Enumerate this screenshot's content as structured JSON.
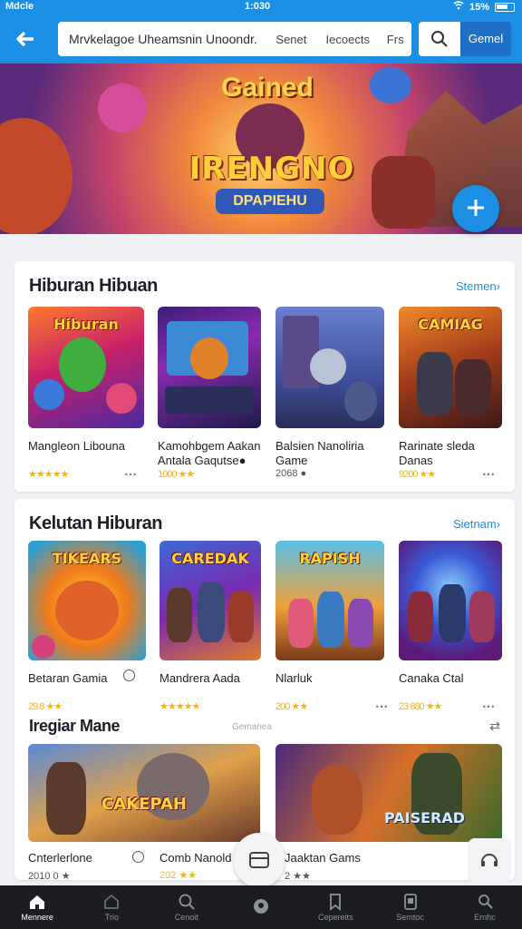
{
  "status_bar": {
    "carrier": "Mdcle",
    "time": "1:030",
    "battery": "15%"
  },
  "topbar": {
    "search_query": "Mrvkelagoe Uheamsnin Unoondr.",
    "filter_1": "Senet",
    "filter_2": "Iecoects",
    "filter_3": "Frs",
    "submit_label": "Gemel"
  },
  "hero": {
    "title_top": "Gained",
    "title_main": "IRENGNO",
    "title_sub": "DPAPIEHU"
  },
  "section1": {
    "title": "Hiburan Hibuan",
    "see_all": "Stemen›",
    "items": [
      {
        "name": "Mangleon Libouna",
        "meta": "★★★★★",
        "art_label": "Hiburan"
      },
      {
        "name": "Kamohbgem Aakan Antala Gaqutse●",
        "meta": "1000 ★★",
        "art_label": ""
      },
      {
        "name": "Balsien Nanoliria Game",
        "meta": "2068 ●",
        "art_label": ""
      },
      {
        "name": "Rarinate sleda Danas",
        "meta": "9200 ★★",
        "art_label": "CAMIAG"
      }
    ]
  },
  "section2": {
    "title": "Kelutan Hiburan",
    "see_all": "Sietnam›",
    "items": [
      {
        "name": "Betaran Gamia",
        "meta": "29.8 ★★",
        "art_label": "TIKEARS"
      },
      {
        "name": "Mandrera Aada",
        "meta": "★★★★★",
        "art_label": "CAREDAK"
      },
      {
        "name": "Nlarluk",
        "meta": "200 ★★",
        "art_label": "RAPISH"
      },
      {
        "name": "Canaka Ctal",
        "meta": "23 880 ★★",
        "art_label": ""
      }
    ]
  },
  "section3": {
    "title": "Iregiar Mane",
    "link": "Gemanea",
    "items": [
      {
        "name": "Cnterlerlone",
        "meta": "2010 0 ★",
        "art_label": "CAKEPAH"
      },
      {
        "name": "Comb Nanold",
        "meta": "202 ★★",
        "art_label": ""
      },
      {
        "name": "Jaaktan Gams",
        "meta": "2 ★★",
        "art_label": "PAISERAD"
      }
    ]
  },
  "bottom_nav": [
    {
      "label": "Mennere",
      "icon": "home-icon"
    },
    {
      "label": "Trio",
      "icon": "store-icon"
    },
    {
      "label": "Cenoit",
      "icon": "search-icon"
    },
    {
      "label": "",
      "icon": "location-icon"
    },
    {
      "label": "Cepereits",
      "icon": "bookmark-icon"
    },
    {
      "label": "Semtoc",
      "icon": "tablet-icon"
    },
    {
      "label": "Ernhc",
      "icon": "profile-icon"
    }
  ],
  "colors": {
    "primary": "#1a8fe3",
    "nav_bg": "#1b1d22",
    "star": "#f2b807"
  }
}
